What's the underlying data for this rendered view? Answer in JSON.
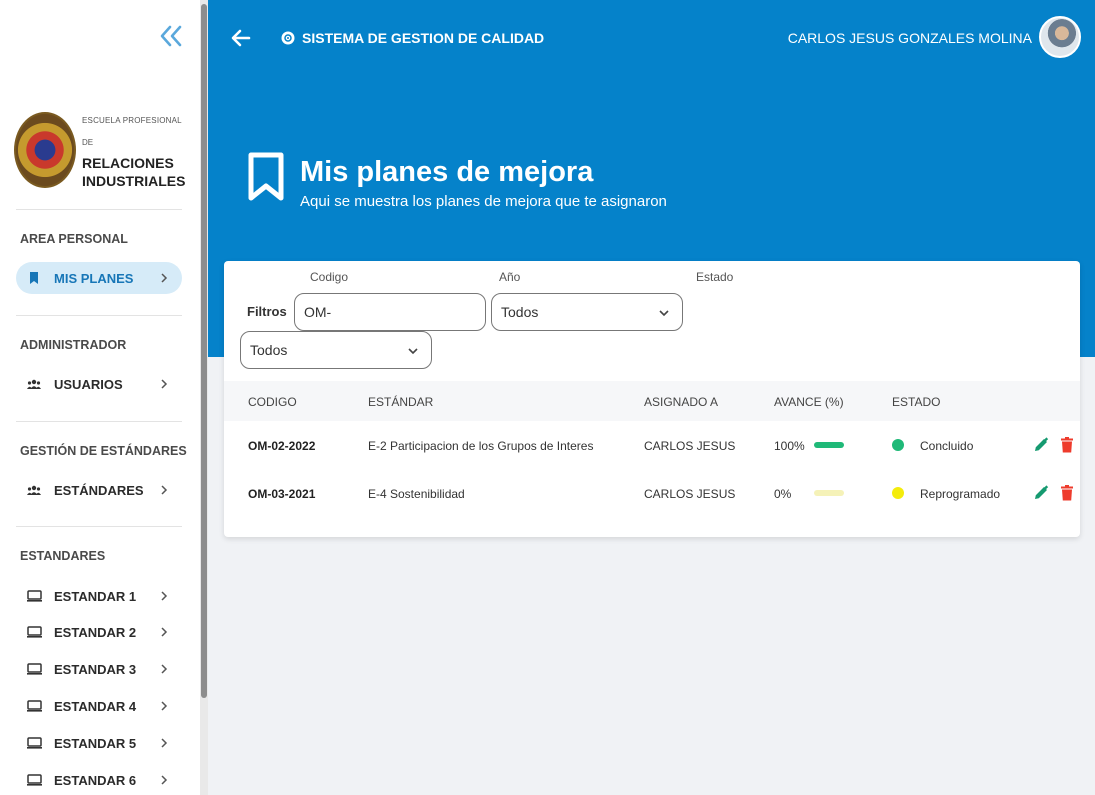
{
  "sidebar": {
    "logo": {
      "line1": "ESCUELA PROFESIONAL",
      "line2": "DE",
      "name": "RELACIONES INDUSTRIALES"
    },
    "sections": [
      {
        "title": "AREA PERSONAL",
        "items": [
          {
            "label": "MIS PLANES",
            "icon": "bookmark-icon",
            "active": true
          }
        ]
      },
      {
        "title": "ADMINISTRADOR",
        "items": [
          {
            "label": "USUARIOS",
            "icon": "users-icon"
          }
        ]
      },
      {
        "title": "GESTIÓN DE ESTÁNDARES",
        "items": [
          {
            "label": "ESTÁNDARES",
            "icon": "users-icon"
          }
        ]
      },
      {
        "title": "ESTANDARES",
        "items": [
          {
            "label": "ESTANDAR 1",
            "icon": "monitor-icon"
          },
          {
            "label": "ESTANDAR 2",
            "icon": "monitor-icon"
          },
          {
            "label": "ESTANDAR 3",
            "icon": "monitor-icon"
          },
          {
            "label": "ESTANDAR 4",
            "icon": "monitor-icon"
          },
          {
            "label": "ESTANDAR 5",
            "icon": "monitor-icon"
          },
          {
            "label": "ESTANDAR 6",
            "icon": "monitor-icon"
          }
        ]
      }
    ]
  },
  "header": {
    "system_title": "SISTEMA DE GESTION DE CALIDAD",
    "user_name": "CARLOS JESUS GONZALES MOLINA",
    "page_title": "Mis planes de mejora",
    "page_subtitle": "Aqui se muestra los planes de mejora que te asignaron"
  },
  "filters": {
    "label": "Filtros",
    "codigo_label": "Codigo",
    "codigo_value": "OM-",
    "anio_label": "Año",
    "anio_value": "Todos",
    "estado_label": "Estado",
    "estado_value": "Todos"
  },
  "table": {
    "columns": [
      "CODIGO",
      "ESTÁNDAR",
      "ASIGNADO A",
      "AVANCE (%)",
      "ESTADO"
    ],
    "rows": [
      {
        "codigo": "OM-02-2022",
        "estandar": "E-2 Participacion de los Grupos de Interes",
        "asignado": "CARLOS JESUS",
        "avance": "100%",
        "progress": 1.0,
        "estado": "Concluido",
        "status_color": "#1fb978",
        "bar_color": "#1fb978"
      },
      {
        "codigo": "OM-03-2021",
        "estandar": "E-4 Sostenibilidad",
        "asignado": "CARLOS JESUS",
        "avance": "0%",
        "progress": 0.0,
        "estado": "Reprogramado",
        "status_color": "#f4ec0c",
        "bar_color": "#f5f2b8"
      }
    ]
  },
  "colors": {
    "primary": "#0582ca",
    "active_bg": "#d6ebf8",
    "edit": "#159a70",
    "delete": "#ee3b2c"
  }
}
